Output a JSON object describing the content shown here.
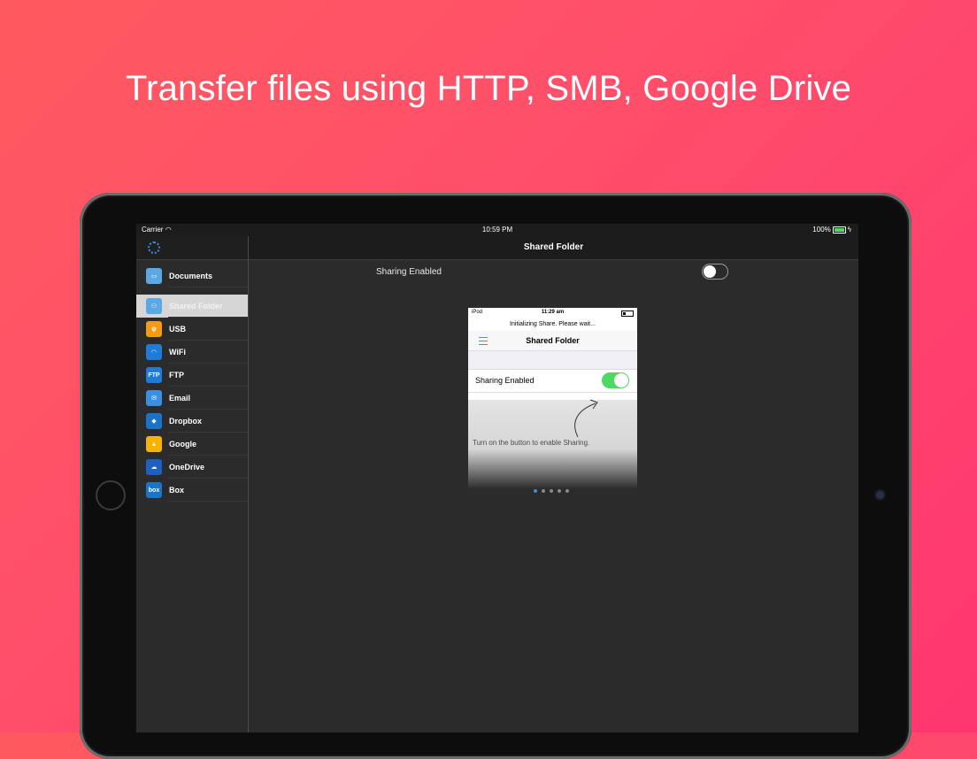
{
  "headline": "Transfer files using HTTP, SMB, Google Drive",
  "statusbar": {
    "carrier": "Carrier",
    "time": "10:59 PM",
    "battery": "100%"
  },
  "topbar": {
    "title": "Shared Folder"
  },
  "sidebar": {
    "items": [
      {
        "label": "Documents",
        "icon": "folder-icon",
        "color": "#5aa9e6",
        "glyph": "▭"
      },
      {
        "label": "Shared Folder",
        "icon": "people-icon",
        "color": "#5aa9e6",
        "glyph": "⚇",
        "selected": true
      },
      {
        "label": "USB",
        "icon": "usb-icon",
        "color": "#f39c12",
        "glyph": "ψ"
      },
      {
        "label": "WiFi",
        "icon": "wifi-icon",
        "color": "#1e7bd8",
        "glyph": "◠"
      },
      {
        "label": "FTP",
        "icon": "ftp-icon",
        "color": "#1e7bd8",
        "glyph": "FTP"
      },
      {
        "label": "Email",
        "icon": "mail-icon",
        "color": "#3b8fe0",
        "glyph": "✉"
      },
      {
        "label": "Dropbox",
        "icon": "dropbox-icon",
        "color": "#1b73c9",
        "glyph": "◆"
      },
      {
        "label": "Google",
        "icon": "google-drive-icon",
        "color": "#f4b400",
        "glyph": "▲"
      },
      {
        "label": "OneDrive",
        "icon": "onedrive-icon",
        "color": "#1e5fbf",
        "glyph": "☁"
      },
      {
        "label": "Box",
        "icon": "box-icon",
        "color": "#1a74c9",
        "glyph": "box"
      }
    ]
  },
  "sharing": {
    "label": "Sharing Enabled",
    "enabled": false
  },
  "preview": {
    "carrier": "iPod",
    "time": "11:29 am",
    "init_text": "Initializing Share. Please wait...",
    "title": "Shared Folder",
    "row_label": "Sharing Enabled",
    "hint": "Turn on the button to enable Sharing."
  },
  "pager": {
    "count": 5,
    "active": 0
  }
}
